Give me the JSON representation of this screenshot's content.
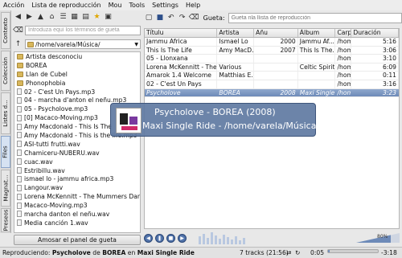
{
  "menu": [
    "Acción",
    "Lista de reproducción",
    "Mou",
    "Tools",
    "Settings",
    "Help"
  ],
  "side_tabs": [
    "Contexto",
    "Colección",
    "Listes d...",
    "Files",
    "Magnat...",
    "Preseos"
  ],
  "left_panel": {
    "filter_placeholder": "Introduza equí los términos de gueta",
    "path": "/home/varela/Música/",
    "files": [
      {
        "name": "Artista desconociu",
        "type": "folder"
      },
      {
        "name": "BOREA",
        "type": "folder"
      },
      {
        "name": "Llan de Cubel",
        "type": "folder"
      },
      {
        "name": "Phonophobia",
        "type": "folder"
      },
      {
        "name": "02 - C'est Un Pays.mp3",
        "type": "file"
      },
      {
        "name": "04 - marcha d'anton el neñu.mp3",
        "type": "file"
      },
      {
        "name": "05 - Psycholove.mp3",
        "type": "file"
      },
      {
        "name": "[0] Macaco-Moving.mp3",
        "type": "file"
      },
      {
        "name": "Amy Macdonald - This Is The",
        "type": "file"
      },
      {
        "name": "Amy Macdonald - This is the life.mp3",
        "type": "file"
      },
      {
        "name": "ASI-tutti frutti.wav",
        "type": "file"
      },
      {
        "name": "Chamiceru-NUBERU.wav",
        "type": "file"
      },
      {
        "name": "cuac.wav",
        "type": "file"
      },
      {
        "name": "Estribillu.wav",
        "type": "file"
      },
      {
        "name": "ismael lo - jammu africa.mp3",
        "type": "file"
      },
      {
        "name": "Langour.wav",
        "type": "file"
      },
      {
        "name": "Lorena McKennitt - The Mummers Dance",
        "type": "file"
      },
      {
        "name": "Macaco-Moving.mp3",
        "type": "file"
      },
      {
        "name": "marcha danton el neñu.wav",
        "type": "file"
      },
      {
        "name": "Media canción 1.wav",
        "type": "file"
      }
    ],
    "bottom_button": "Amosar el panel de gueta"
  },
  "search_bar": {
    "label": "Gueta:",
    "placeholder": "Gueta nla llista de reproducción"
  },
  "playlist": {
    "columns": [
      "Títulu",
      "Artista",
      "Añu",
      "Álbum",
      "Carpe",
      "Duración"
    ],
    "rows": [
      {
        "title": "Jammu Africa",
        "artist": "Ismael Lo",
        "year": "2000",
        "album": "Jammu Af...",
        "folder": "/home/",
        "duration": "5:16",
        "playing": false
      },
      {
        "title": "This Is The Life",
        "artist": "Amy MacD...",
        "year": "2007",
        "album": "This Is The...",
        "folder": "/home/",
        "duration": "3:06",
        "playing": false
      },
      {
        "title": "05 - Llonxana",
        "artist": "",
        "year": "",
        "album": "",
        "folder": "/home/",
        "duration": "3:10",
        "playing": false
      },
      {
        "title": "Lorena McKennitt - The ...",
        "artist": "Various",
        "year": "",
        "album": "Celtic Spirit",
        "folder": "/home/",
        "duration": "6:09",
        "playing": false
      },
      {
        "title": "Amarok 1.4 Welcome",
        "artist": "Matthias E...",
        "year": "",
        "album": "",
        "folder": "/home/",
        "duration": "0:11",
        "playing": false
      },
      {
        "title": "02 - C'est Un Pays",
        "artist": "",
        "year": "",
        "album": "",
        "folder": "/home/",
        "duration": "3:16",
        "playing": false
      },
      {
        "title": "Psycholove",
        "artist": "BOREA",
        "year": "2008",
        "album": "Maxi Single...",
        "folder": "/home/",
        "duration": "3:23",
        "playing": true
      }
    ]
  },
  "tooltip": {
    "line1": "Psycholove - BOREA (2008)",
    "line2": "Maxi Single Ride - /home/varela/Música (3:23)"
  },
  "status": {
    "prefix": "Reproduciendo:",
    "track": "Psycholove",
    "by": "de",
    "artist": "BOREA",
    "on": "en",
    "album": "Maxi Single Ride",
    "tracks": "7 tracks (21:56)",
    "elapsed": "0:05",
    "remaining": "-3:18",
    "progress": 0.025
  },
  "volume_label": "80%",
  "volume_level": 0.8
}
